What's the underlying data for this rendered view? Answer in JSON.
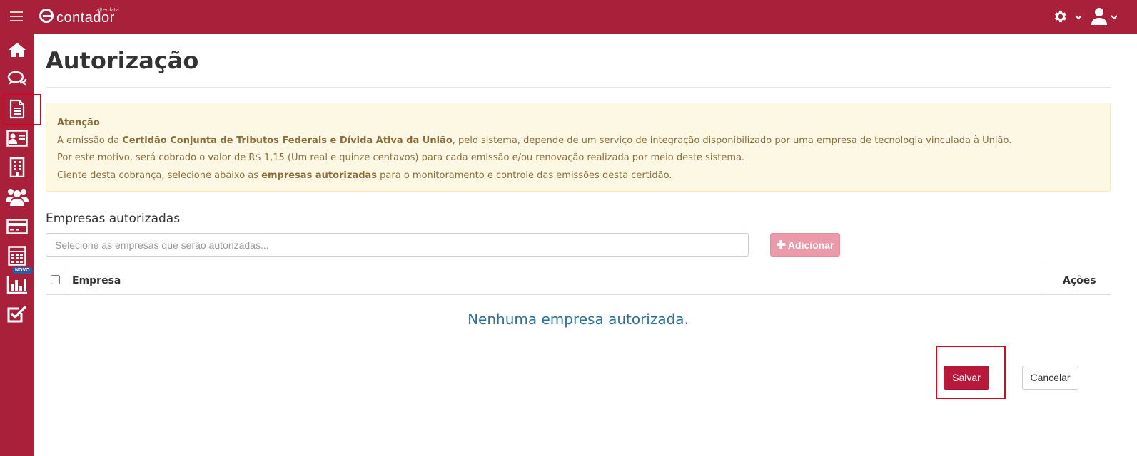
{
  "app": {
    "logo_text": "contador",
    "logo_small": "alterdata"
  },
  "topbar": {
    "menu_icon": "hamburger-icon",
    "settings_icon": "gear-icon",
    "user_icon": "user-icon"
  },
  "sidebar": {
    "items": [
      {
        "icon": "home-icon"
      },
      {
        "icon": "chat-icon"
      },
      {
        "icon": "document-icon"
      },
      {
        "icon": "id-card-icon"
      },
      {
        "icon": "building-icon"
      },
      {
        "icon": "users-icon"
      },
      {
        "icon": "credit-card-icon"
      },
      {
        "icon": "calculator-icon"
      },
      {
        "icon": "bar-chart-icon"
      },
      {
        "icon": "checkbox-icon"
      }
    ],
    "novo_badge": "NOVO"
  },
  "page": {
    "title": "Autorização"
  },
  "alert": {
    "title": "Atenção",
    "line1_pre": "A emissão da ",
    "line1_bold": "Certidão Conjunta de Tributos Federais e Dívida Ativa da União",
    "line1_post": ", pelo sistema, depende de um serviço de integração disponibilizado por uma empresa de tecnologia vinculada à União.",
    "line2": "Por este motivo, será cobrado o valor de R$ 1,15 (Um real e quinze centavos) para cada emissão e/ou renovação realizada por meio deste sistema.",
    "line3_pre": "Ciente desta cobrança, selecione abaixo as ",
    "line3_bold": "empresas autorizadas",
    "line3_post": " para o monitoramento e controle das emissões desta certidão."
  },
  "companies": {
    "label": "Empresas autorizadas",
    "select_placeholder": "Selecione as empresas que serão autorizadas...",
    "add_button": "Adicionar"
  },
  "table": {
    "columns": [
      "Empresa",
      "Ações"
    ],
    "empty_message": "Nenhuma empresa autorizada."
  },
  "actions": {
    "save": "Salvar",
    "cancel": "Cancelar"
  },
  "colors": {
    "brand": "#a8203a",
    "alert_bg": "#fcf8e3",
    "alert_text": "#8a6d3b",
    "empty_text": "#31708f",
    "highlight": "#e0001a"
  }
}
